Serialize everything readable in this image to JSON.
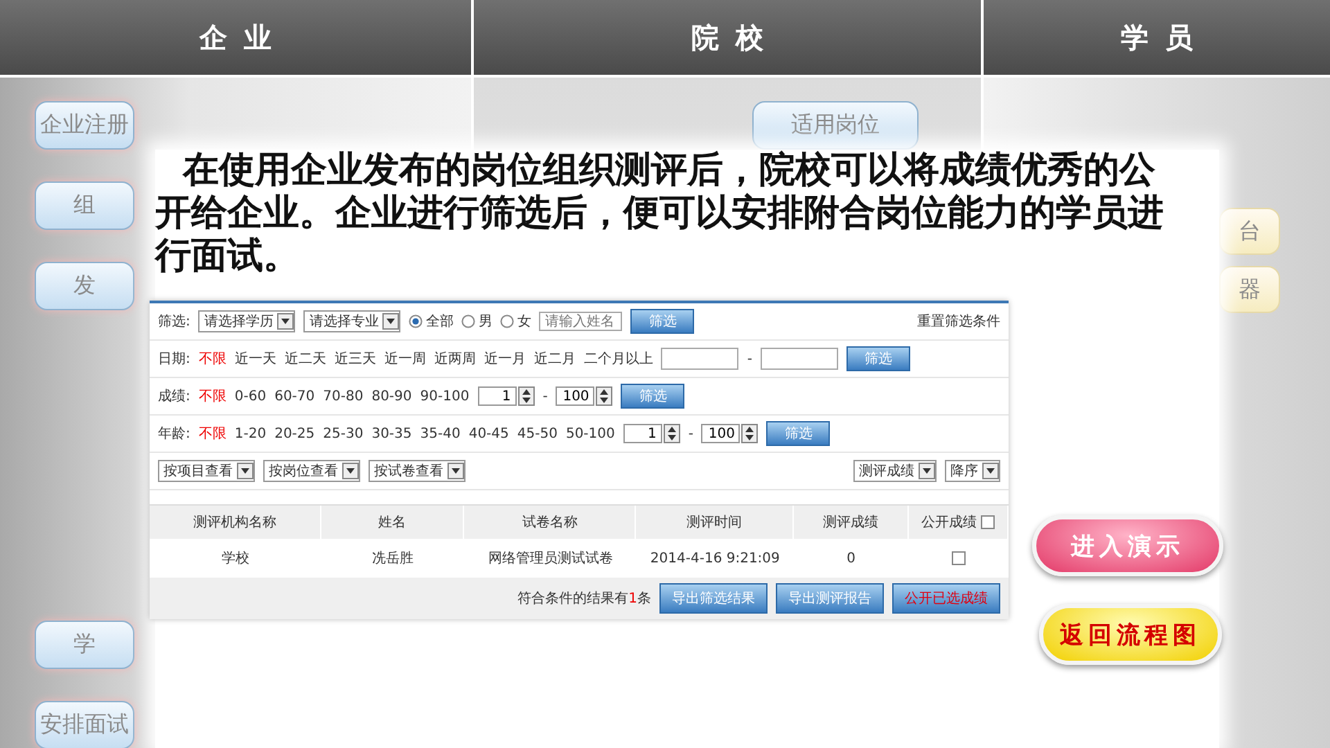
{
  "header_tabs": [
    {
      "label": "企业"
    },
    {
      "label": "院校"
    },
    {
      "label": "学员"
    }
  ],
  "background_buttons": {
    "left": [
      {
        "label": "企业注册"
      },
      {
        "label": "组"
      },
      {
        "label": "发"
      },
      {
        "label": "学"
      },
      {
        "label": "安排面试"
      }
    ],
    "center": [
      {
        "label": "适用岗位"
      }
    ],
    "right": [
      {
        "label": "台"
      },
      {
        "label": "器"
      }
    ]
  },
  "description": "在使用企业发布的岗位组织测评后，院校可以将成绩优秀的公开给企业。企业进行筛选后，便可以安排附合岗位能力的学员进行面试。",
  "screenshot": {
    "filter_row": {
      "label": "筛选:",
      "selects": [
        "请选择学历",
        "请选择专业"
      ],
      "gender": [
        {
          "label": "全部",
          "selected": true
        },
        {
          "label": "男",
          "selected": false
        },
        {
          "label": "女",
          "selected": false
        }
      ],
      "name_placeholder": "请输入姓名",
      "button": "筛选",
      "reset_link": "重置筛选条件"
    },
    "range_filters": [
      {
        "kind": "date",
        "label": "日期:",
        "options": [
          {
            "label": "不限",
            "selected": true
          },
          {
            "label": "近一天",
            "selected": false
          },
          {
            "label": "近二天",
            "selected": false
          },
          {
            "label": "近三天",
            "selected": false
          },
          {
            "label": "近一周",
            "selected": false
          },
          {
            "label": "近两周",
            "selected": false
          },
          {
            "label": "近一月",
            "selected": false
          },
          {
            "label": "近二月",
            "selected": false
          },
          {
            "label": "二个月以上",
            "selected": false
          }
        ],
        "separator": "-",
        "button": "筛选"
      },
      {
        "kind": "spin",
        "label": "成绩:",
        "options": [
          {
            "label": "不限",
            "selected": true
          },
          {
            "label": "0-60",
            "selected": false
          },
          {
            "label": "60-70",
            "selected": false
          },
          {
            "label": "70-80",
            "selected": false
          },
          {
            "label": "80-90",
            "selected": false
          },
          {
            "label": "90-100",
            "selected": false
          }
        ],
        "from": "1",
        "separator": "-",
        "to": "100",
        "button": "筛选"
      },
      {
        "kind": "spin",
        "label": "年龄:",
        "options": [
          {
            "label": "不限",
            "selected": true
          },
          {
            "label": "1-20",
            "selected": false
          },
          {
            "label": "20-25",
            "selected": false
          },
          {
            "label": "25-30",
            "selected": false
          },
          {
            "label": "30-35",
            "selected": false
          },
          {
            "label": "35-40",
            "selected": false
          },
          {
            "label": "40-45",
            "selected": false
          },
          {
            "label": "45-50",
            "selected": false
          },
          {
            "label": "50-100",
            "selected": false
          }
        ],
        "from": "1",
        "separator": "-",
        "to": "100",
        "button": "筛选"
      }
    ],
    "view_selects": [
      "按项目查看",
      "按岗位查看",
      "按试卷查看"
    ],
    "sort_selects": [
      "测评成绩",
      "降序"
    ],
    "table": {
      "columns": [
        "测评机构名称",
        "姓名",
        "试卷名称",
        "测评时间",
        "测评成绩",
        "公开成绩"
      ],
      "header_checked": false,
      "rows": [
        {
          "cells": [
            "学校",
            "冼岳胜",
            "网络管理员测试试卷",
            "2014-4-16 9:21:09",
            "0"
          ],
          "checked": false
        }
      ]
    },
    "result_text": "符合条件的结果有**1**条",
    "footer_buttons": [
      {
        "label": "导出筛选结果",
        "kind": "normal"
      },
      {
        "label": "导出测评报告",
        "kind": "normal"
      },
      {
        "label": "公开已选成绩",
        "kind": "danger"
      }
    ]
  },
  "nav_buttons": [
    {
      "label": "进入演示",
      "kind": "pink"
    },
    {
      "label": "返回流程图",
      "kind": "yellow"
    }
  ]
}
